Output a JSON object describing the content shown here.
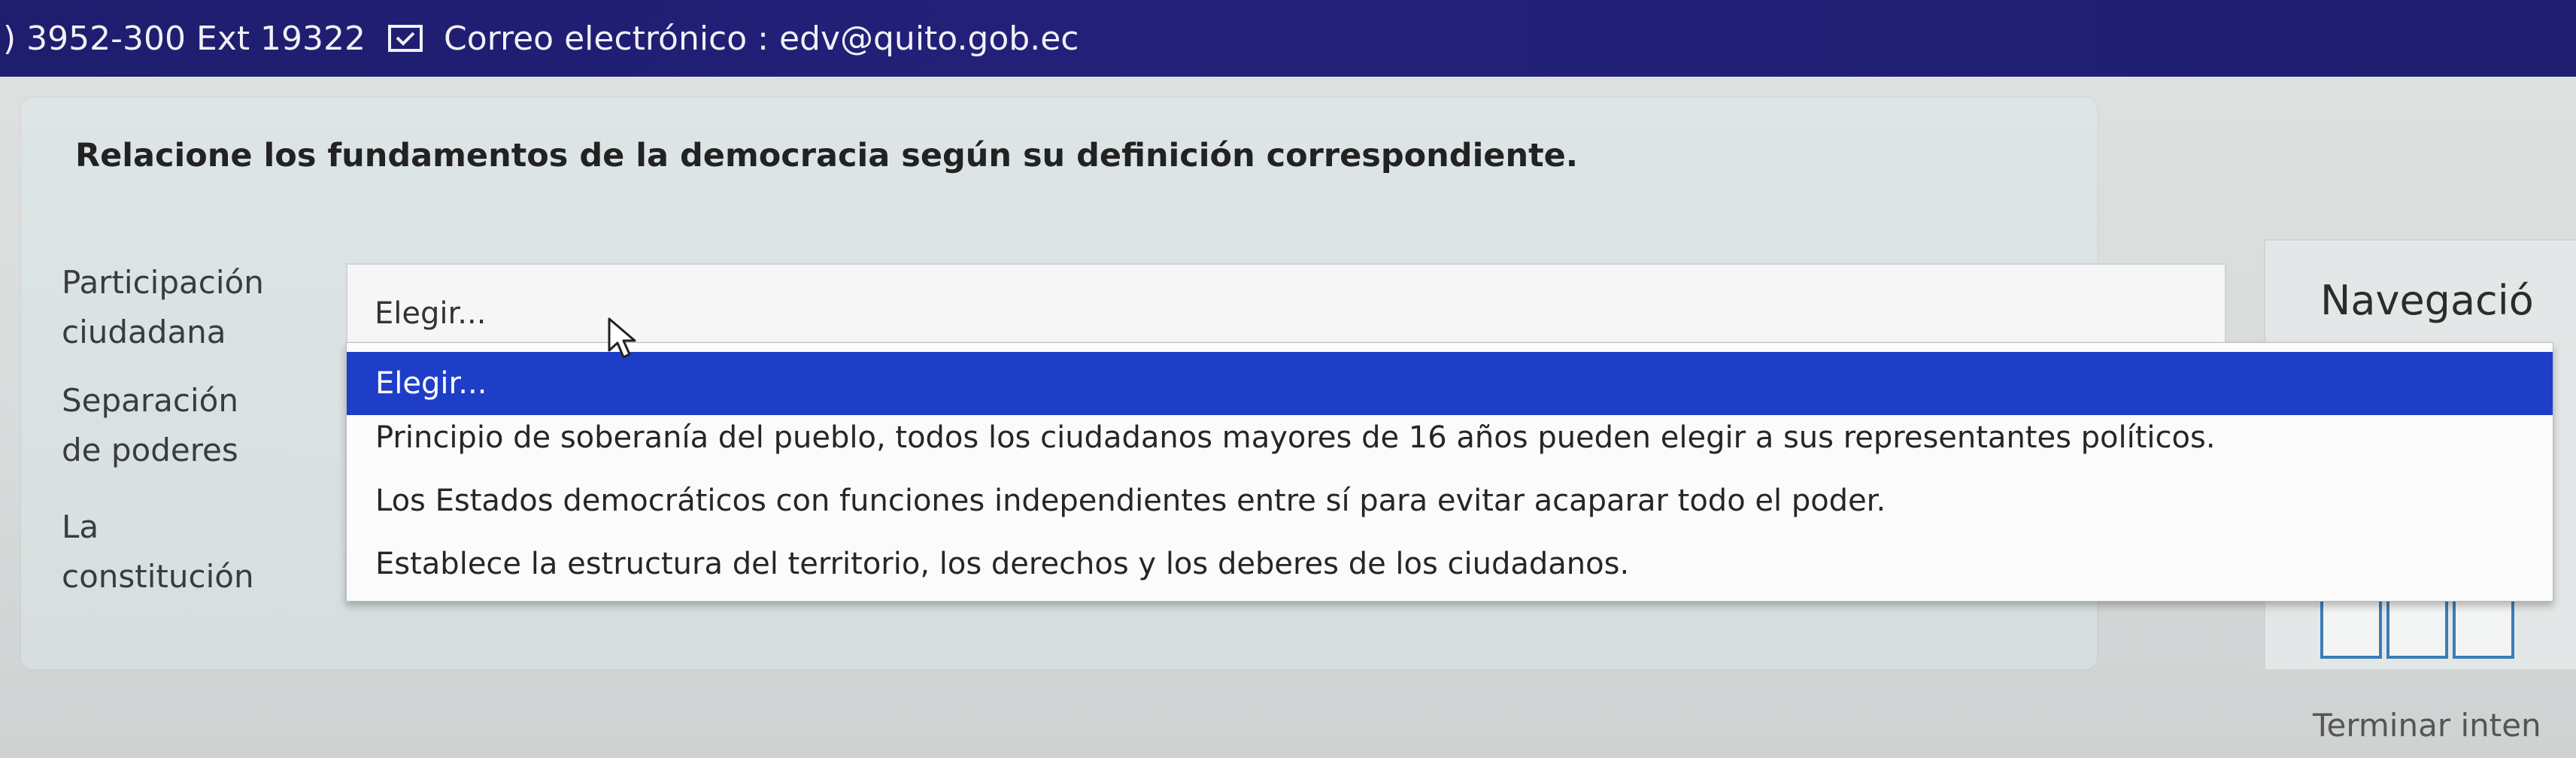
{
  "topbar": {
    "phone": ") 3952-300 Ext 19322",
    "email_label": "Correo electrónico : edv@quito.gob.ec"
  },
  "question": {
    "text": "Relacione los fundamentos de la democracia según su definición correspondiente."
  },
  "items": [
    {
      "label_line1": "Participación",
      "label_line2": "ciudadana"
    },
    {
      "label_line1": "Separación",
      "label_line2": "de poderes"
    },
    {
      "label_line1": "La",
      "label_line2": "constitución"
    }
  ],
  "select": {
    "current_value": "Elegir..."
  },
  "dropdown": {
    "options": [
      "Elegir...",
      "Principio de soberanía del pueblo, todos los ciudadanos mayores de 16 años pueden elegir a sus representantes políticos.",
      "Los Estados democráticos con funciones independientes entre sí para evitar acaparar todo el poder.",
      "Establece la estructura del territorio, los derechos y los deberes de los ciudadanos."
    ],
    "selected_index": 0
  },
  "navigation": {
    "title": "Navegació",
    "finish_label": "Terminar inten"
  },
  "colors": {
    "topbar": "#201e72",
    "selected_option": "#1f3ec8",
    "nav_box_border": "#3a7db8"
  },
  "icons": {
    "email": "envelope-check-icon",
    "cursor": "mouse-pointer-icon"
  }
}
